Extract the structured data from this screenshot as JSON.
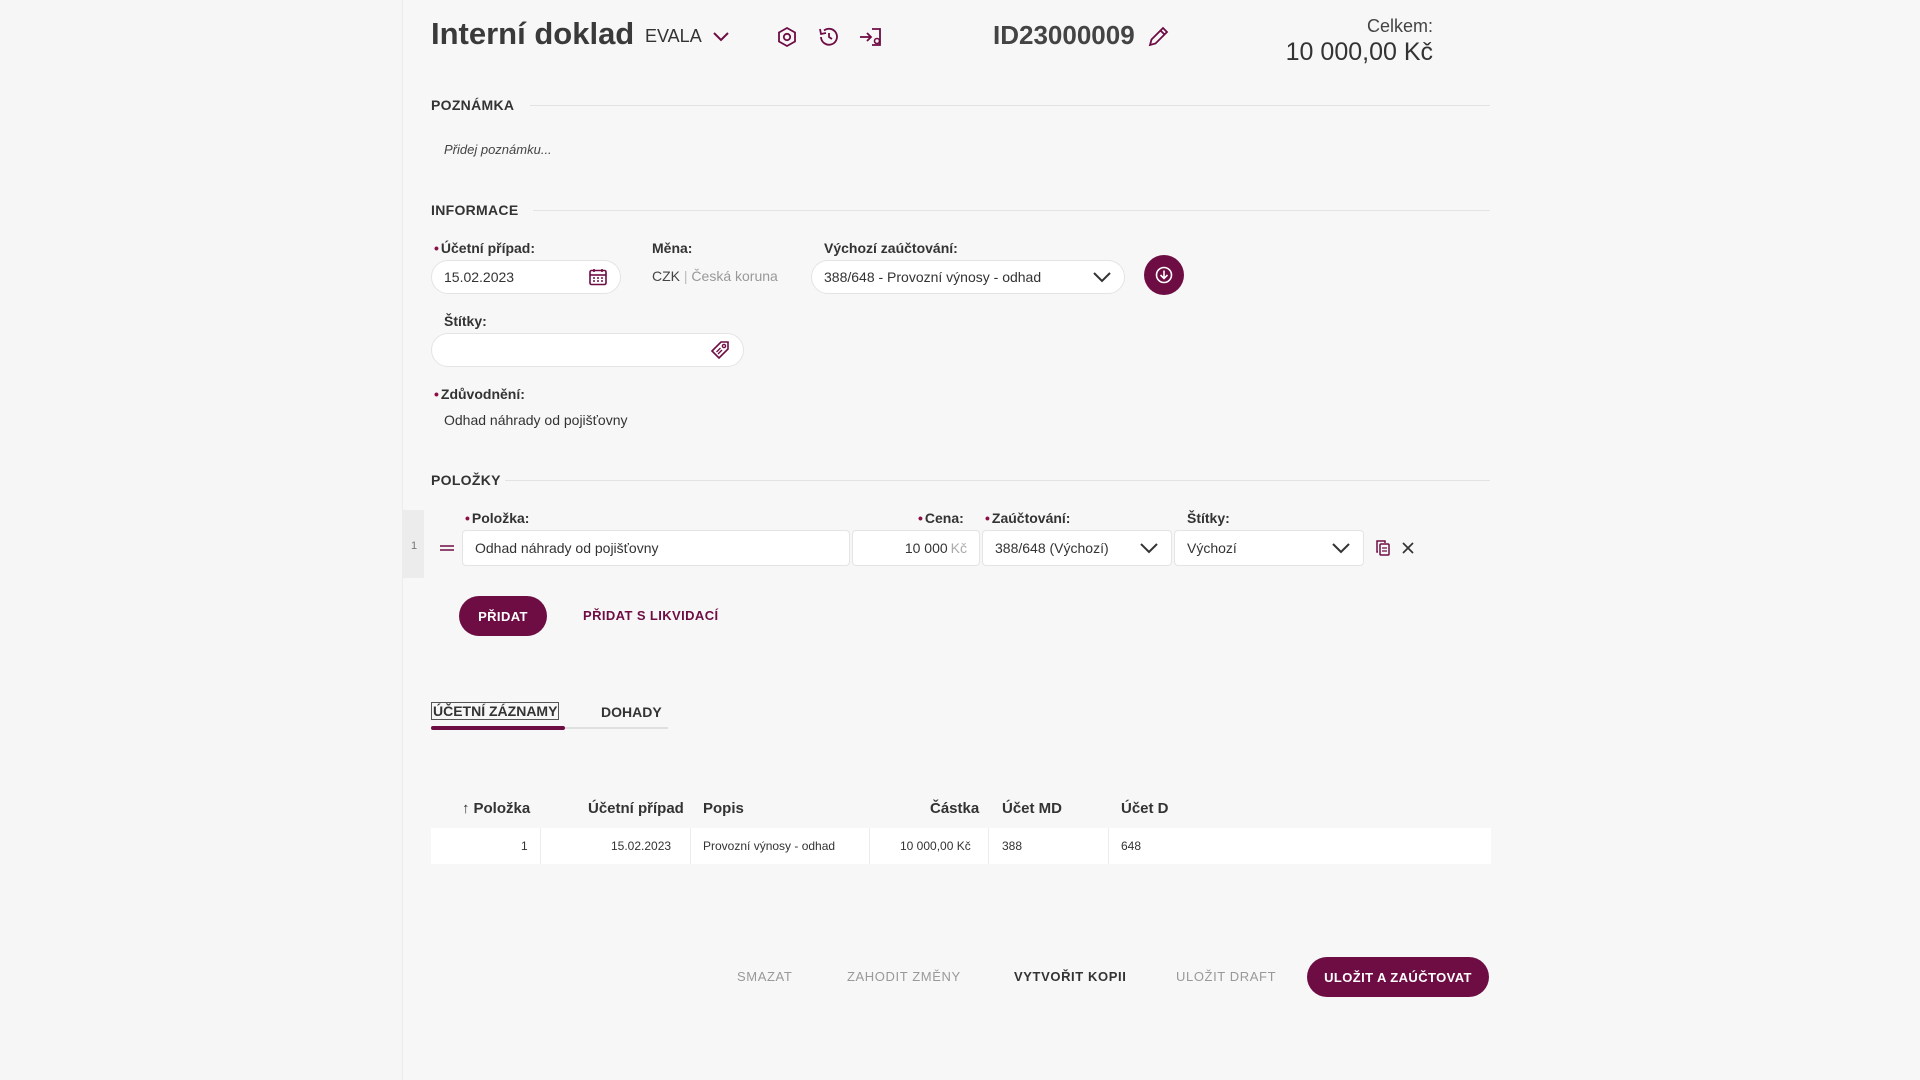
{
  "header": {
    "title": "Interní doklad",
    "company": "EVALA",
    "doc_id": "ID23000009",
    "total_label": "Celkem:",
    "total_value": "10 000,00 Kč"
  },
  "note_section": {
    "heading": "POZNÁMKA",
    "placeholder": "Přidej poznámku..."
  },
  "info": {
    "heading": "INFORMACE",
    "date_label": "Účetní případ:",
    "date_value": "15.02.2023",
    "currency_label": "Měna:",
    "currency_code": "CZK",
    "currency_sep": "|",
    "currency_name": "Česká koruna",
    "posting_label": "Výchozí zaúčtování:",
    "posting_value": "388/648 - Provozní výnosy - odhad",
    "tags_label": "Štítky:",
    "tags_value": "",
    "reason_label": "Zdůvodnění:",
    "reason_value": "Odhad náhrady od pojišťovny"
  },
  "items": {
    "heading": "POLOŽKY",
    "col_item": "Položka:",
    "col_price": "Cena:",
    "col_posting": "Zaúčtování:",
    "col_tags": "Štítky:",
    "rows": [
      {
        "index": "1",
        "item": "Odhad náhrady od pojišťovny",
        "price": "10 000",
        "currency": "Kč",
        "posting": "388/648 (Výchozí)",
        "tags": "Výchozí"
      }
    ],
    "add_label": "PŘIDAT",
    "add_liquidation_label": "PŘIDAT S LIKVIDACÍ"
  },
  "tabs": [
    {
      "label": "ÚČETNÍ ZÁZNAMY",
      "active": true
    },
    {
      "label": "DOHADY",
      "active": false
    }
  ],
  "records_table": {
    "sort_arrow": "↑",
    "headers": [
      "Položka",
      "Účetní případ",
      "Popis",
      "Částka",
      "Účet MD",
      "Účet D"
    ],
    "rows": [
      [
        "1",
        "15.02.2023",
        "Provozní výnosy - odhad",
        "10 000,00 Kč",
        "388",
        "648"
      ]
    ]
  },
  "footer": {
    "delete": "SMAZAT",
    "discard": "ZAHODIT ZMĚNY",
    "copy": "VYTVOŘIT KOPII",
    "draft": "ULOŽIT DRAFT",
    "save_post": "ULOŽIT A ZAÚČTOVAT"
  },
  "colors": {
    "accent": "#6e0d44",
    "required": "#8a1048",
    "background": "#f7f7f7"
  },
  "icons": [
    "chevron-down-icon",
    "settings-icon",
    "history-icon",
    "export-icon",
    "pencil-icon",
    "calendar-icon",
    "tag-icon",
    "arrow-down-circle-icon",
    "drag-handle-icon",
    "copy-icon",
    "close-icon",
    "sort-up-icon"
  ]
}
